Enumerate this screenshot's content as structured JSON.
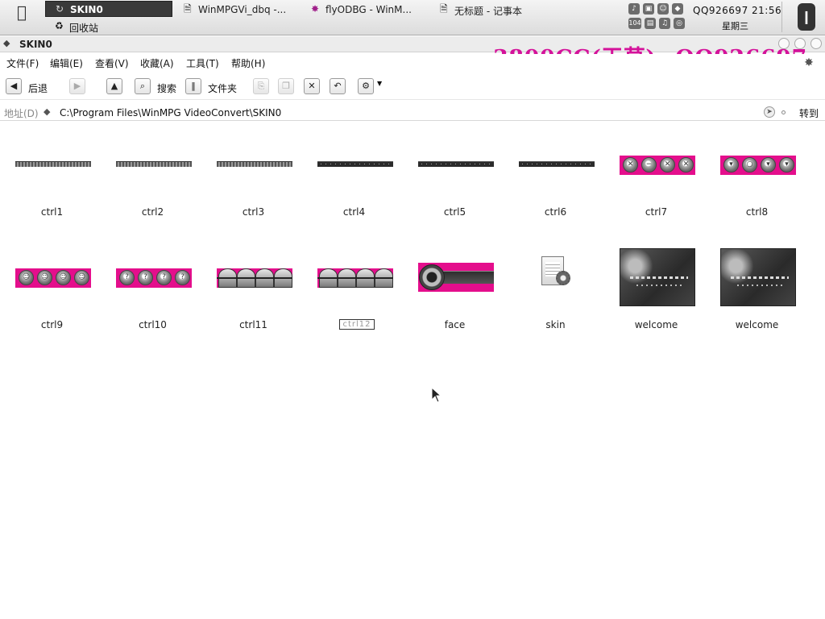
{
  "taskbar": {
    "active_task": "SKIN0",
    "tasks": [
      "WinMPGVi_dbq -...",
      "flyODBG - WinM...",
      "无标题 - 记事本"
    ],
    "recycle_bin": "回收站",
    "clock_line1": "QQ926697 21:56",
    "clock_line2": "星期三",
    "tray_number": "104"
  },
  "window": {
    "title": "SKIN0",
    "watermark": "3800CC(天草)--QQ926697"
  },
  "menu": {
    "file": "文件(F)",
    "edit": "编辑(E)",
    "view": "查看(V)",
    "favorites": "收藏(A)",
    "tools": "工具(T)",
    "help": "帮助(H)"
  },
  "toolbar": {
    "back": "后退",
    "search": "搜索",
    "folders": "文件夹"
  },
  "address": {
    "label": "地址(D)",
    "path": "C:\\Program Files\\WinMPG VideoConvert\\SKIN0",
    "go": "转到"
  },
  "files": [
    {
      "name": "ctrl1"
    },
    {
      "name": "ctrl2"
    },
    {
      "name": "ctrl3"
    },
    {
      "name": "ctrl4"
    },
    {
      "name": "ctrl5"
    },
    {
      "name": "ctrl6"
    },
    {
      "name": "ctrl7"
    },
    {
      "name": "ctrl8"
    },
    {
      "name": "ctrl9"
    },
    {
      "name": "ctrl10"
    },
    {
      "name": "ctrl11"
    },
    {
      "name": "ctrl12"
    },
    {
      "name": "face"
    },
    {
      "name": "skin"
    },
    {
      "name": "welcome"
    },
    {
      "name": "welcome"
    }
  ],
  "colors": {
    "watermark": "#d4129a",
    "thumb_accent": "#e40e8c"
  }
}
